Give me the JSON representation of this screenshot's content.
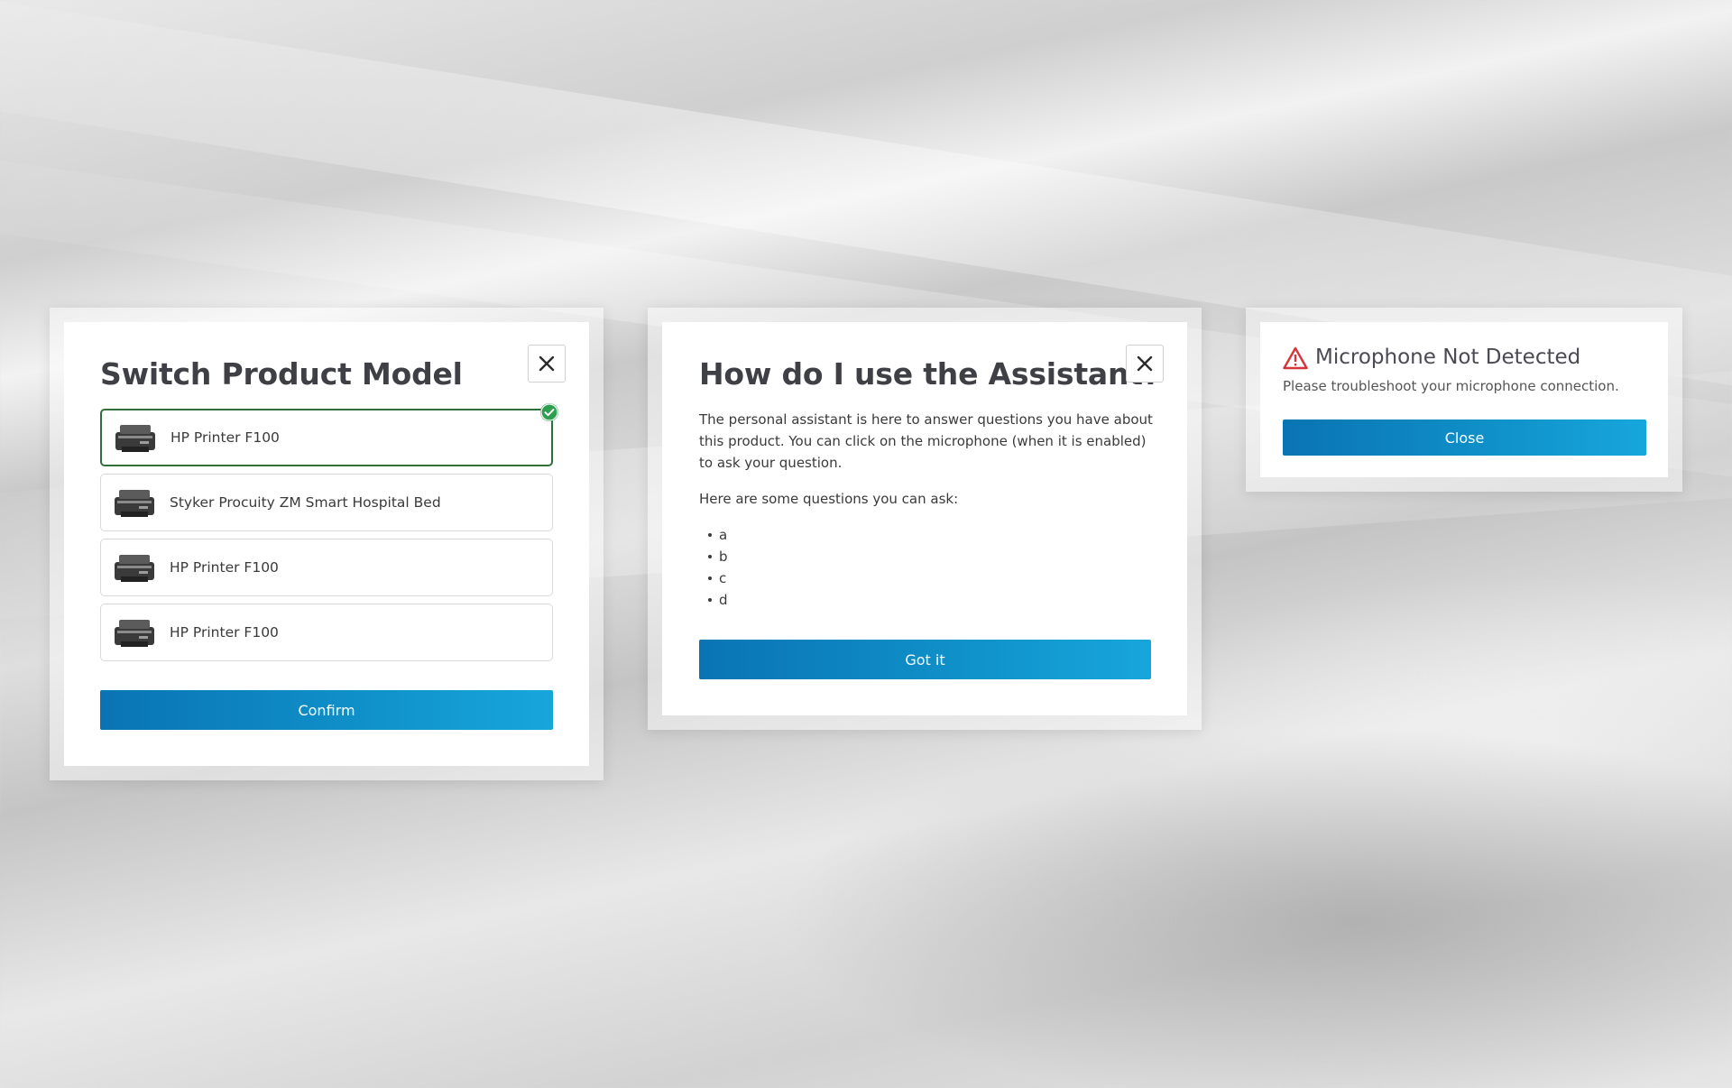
{
  "switch_dialog": {
    "title": "Switch Product Model",
    "products": [
      {
        "name": "HP Printer F100",
        "selected": true
      },
      {
        "name": "Styker Procuity ZM Smart Hospital Bed",
        "selected": false
      },
      {
        "name": "HP Printer F100",
        "selected": false
      },
      {
        "name": "HP Printer F100",
        "selected": false
      }
    ],
    "confirm_label": "Confirm",
    "selected_color": "#2f6f3a",
    "check_color": "#2e9e4f"
  },
  "assistant_dialog": {
    "title": "How do I use the Assistant?",
    "intro": "The personal assistant is here to answer questions you have about this product. You can click on the microphone (when it is enabled) to ask your question.",
    "questions_heading": "Here are some questions you can ask:",
    "questions": [
      "a",
      "b",
      "c",
      "d"
    ],
    "button_label": "Got it"
  },
  "mic_dialog": {
    "title": "Microphone Not Detected",
    "message": "Please troubleshoot your microphone connection.",
    "button_label": "Close",
    "warning_color": "#d6333b"
  },
  "icons": {
    "close": "close-icon",
    "check": "check-circle-icon",
    "warning": "warning-triangle-icon",
    "product_thumb": "printer-image"
  },
  "colors": {
    "primary_button_start": "#0a74b3",
    "primary_button_end": "#17a6dc",
    "title_text": "#3f3f46"
  }
}
